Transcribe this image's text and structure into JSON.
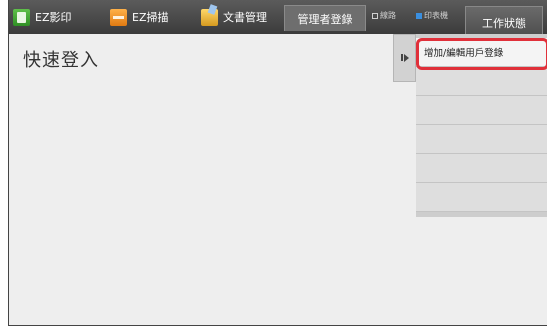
{
  "topbar": {
    "tabs": [
      {
        "label": "EZ影印",
        "icon": "copy-icon"
      },
      {
        "label": "EZ掃描",
        "icon": "scan-icon"
      },
      {
        "label": "文書管理",
        "icon": "document-folder-icon"
      }
    ],
    "admin_login_label": "管理者登錄",
    "status_line_label": "線路",
    "status_printer_label": "印表機",
    "job_status_label": "工作狀態",
    "colors": {
      "printer_indicator": "#3a8fe0"
    }
  },
  "main": {
    "title": "快速登入"
  },
  "side_panel": {
    "items": [
      {
        "label": "增加/編輯用戶登錄"
      },
      {
        "label": ""
      },
      {
        "label": ""
      },
      {
        "label": ""
      },
      {
        "label": ""
      },
      {
        "label": ""
      }
    ],
    "highlight_color": "#e0303a"
  }
}
